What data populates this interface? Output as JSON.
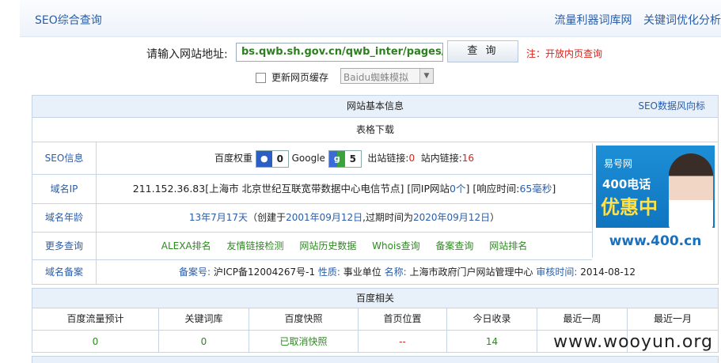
{
  "header": {
    "title": "SEO综合查询",
    "links": [
      "流量利器词库网",
      "关键词优化分析"
    ]
  },
  "query": {
    "label": "请输入网站地址:",
    "url_value": "bs.qwb.sh.gov.cn/qwb_inter/pages/T_QW",
    "button": "查 询",
    "note": "注：开放内页查询",
    "checkbox_label": "更新网页缓存",
    "select_value": "Baidu蜘蛛模拟"
  },
  "basic": {
    "section_title": "网站基本信息",
    "trend_link": "SEO数据风向标",
    "download": "表格下载",
    "seo": {
      "label": "SEO信息",
      "baidu_weight": "百度权重",
      "baidu_value": "0",
      "google": "Google",
      "google_value": "5",
      "out_links_label": "出站链接:",
      "out_links": "0",
      "in_links_label": "站内链接:",
      "in_links": "16"
    },
    "ip": {
      "label": "域名IP",
      "ip": "211.152.36.83",
      "location": "[上海市 北京世纪互联宽带数据中心电信节点]",
      "same_ip_prefix": "[同IP网站",
      "same_ip_count": "0个",
      "same_ip_suffix": "]",
      "resp_prefix": "[响应时间:",
      "resp_time": "65毫秒",
      "resp_suffix": "]"
    },
    "age": {
      "label": "域名年龄",
      "age": "13年7月17天",
      "created_prefix": "（创建于",
      "created": "2001年09月12日",
      "expire_prefix": ",过期时间为",
      "expire": "2020年09月12日",
      "close": "）"
    },
    "more": {
      "label": "更多查询",
      "links": [
        "ALEXA排名",
        "友情链接检测",
        "网站历史数据",
        "Whois查询",
        "备案查询",
        "网站排名"
      ]
    },
    "icp": {
      "label": "域名备案",
      "icp_label": "备案号:",
      "icp": "沪ICP备12004267号-1",
      "nature_label": "性质:",
      "nature": "事业单位",
      "name_label": "名称:",
      "name": "上海市政府门户网站管理中心",
      "audit_label": "审核时间:",
      "audit": "2014-08-12"
    }
  },
  "ad": {
    "brand": "易号网",
    "line1": "400电话",
    "line2": "优惠中",
    "url": "www.400.cn"
  },
  "baidu": {
    "section_title": "百度相关",
    "headers": [
      "百度流量预计",
      "关键词库",
      "百度快照",
      "首页位置",
      "今日收录",
      "最近一周",
      "最近一月"
    ],
    "values": [
      "0",
      "0",
      "已取消快照",
      "--",
      "14",
      "",
      ""
    ]
  },
  "watermark": "www.wooyun.org",
  "colors": {
    "link": "#2a5da8",
    "green": "#2d8a1f",
    "red": "#d8221b",
    "header_bg": "#e8f0f9"
  }
}
